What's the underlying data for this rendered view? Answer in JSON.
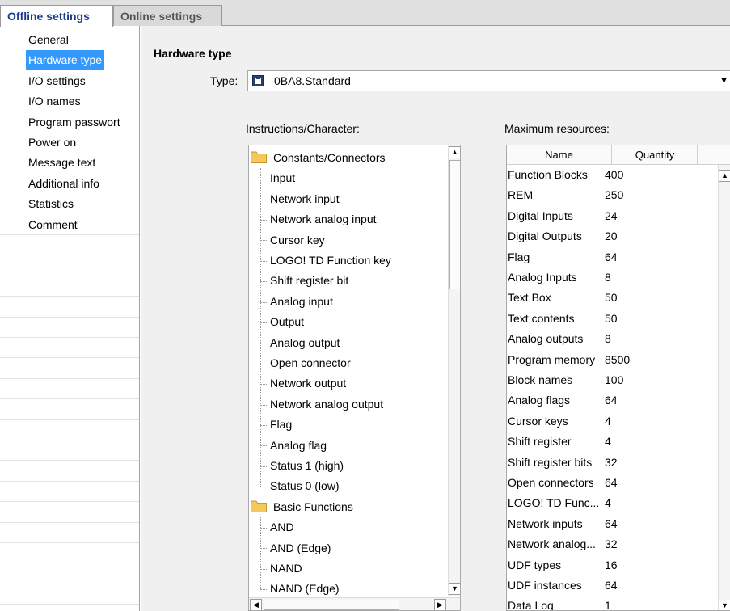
{
  "tabs": [
    {
      "label": "Offline settings",
      "active": true
    },
    {
      "label": "Online settings",
      "active": false
    }
  ],
  "sidebar": {
    "selected_index": 1,
    "items": [
      {
        "label": "General"
      },
      {
        "label": "Hardware type"
      },
      {
        "label": "I/O settings"
      },
      {
        "label": "I/O names"
      },
      {
        "label": "Program passwort"
      },
      {
        "label": "Power on"
      },
      {
        "label": "Message text"
      },
      {
        "label": "Additional info"
      },
      {
        "label": "Statistics"
      },
      {
        "label": "Comment"
      }
    ]
  },
  "hardware": {
    "section_title": "Hardware type",
    "type_label": "Type:",
    "type_value": "0BA8.Standard",
    "instructions_label": "Instructions/Character:",
    "resources_label": "Maximum resources:"
  },
  "instructions_tree": [
    {
      "label": "Constants/Connectors",
      "kind": "folder"
    },
    {
      "label": "Input",
      "kind": "child"
    },
    {
      "label": "Network input",
      "kind": "child"
    },
    {
      "label": "Network analog input",
      "kind": "child"
    },
    {
      "label": "Cursor key",
      "kind": "child"
    },
    {
      "label": "LOGO! TD Function key",
      "kind": "child"
    },
    {
      "label": "Shift register bit",
      "kind": "child"
    },
    {
      "label": "Analog input",
      "kind": "child"
    },
    {
      "label": "Output",
      "kind": "child"
    },
    {
      "label": "Analog output",
      "kind": "child"
    },
    {
      "label": "Open connector",
      "kind": "child"
    },
    {
      "label": "Network output",
      "kind": "child"
    },
    {
      "label": "Network analog output",
      "kind": "child"
    },
    {
      "label": "Flag",
      "kind": "child"
    },
    {
      "label": "Analog flag",
      "kind": "child"
    },
    {
      "label": "Status 1 (high)",
      "kind": "child"
    },
    {
      "label": "Status 0 (low)",
      "kind": "child"
    },
    {
      "label": "Basic Functions",
      "kind": "folder"
    },
    {
      "label": "AND",
      "kind": "child"
    },
    {
      "label": "AND (Edge)",
      "kind": "child"
    },
    {
      "label": "NAND",
      "kind": "child"
    },
    {
      "label": "NAND (Edge)",
      "kind": "child"
    }
  ],
  "resources": {
    "headers": {
      "name": "Name",
      "quantity": "Quantity"
    },
    "rows": [
      {
        "name": "Function Blocks",
        "quantity": "400"
      },
      {
        "name": "REM",
        "quantity": "250"
      },
      {
        "name": "Digital Inputs",
        "quantity": "24"
      },
      {
        "name": "Digital Outputs",
        "quantity": "20"
      },
      {
        "name": "Flag",
        "quantity": "64"
      },
      {
        "name": "Analog Inputs",
        "quantity": "8"
      },
      {
        "name": "Text Box",
        "quantity": "50"
      },
      {
        "name": "Text contents",
        "quantity": "50"
      },
      {
        "name": "Analog outputs",
        "quantity": "8"
      },
      {
        "name": "Program memory",
        "quantity": "8500"
      },
      {
        "name": "Block names",
        "quantity": "100"
      },
      {
        "name": "Analog flags",
        "quantity": "64"
      },
      {
        "name": "Cursor keys",
        "quantity": "4"
      },
      {
        "name": "Shift register",
        "quantity": "4"
      },
      {
        "name": "Shift register bits",
        "quantity": "32"
      },
      {
        "name": "Open connectors",
        "quantity": "64"
      },
      {
        "name": "LOGO! TD Func...",
        "quantity": "4"
      },
      {
        "name": "Network inputs",
        "quantity": "64"
      },
      {
        "name": "Network analog...",
        "quantity": "32"
      },
      {
        "name": "UDF types",
        "quantity": "16"
      },
      {
        "name": "UDF instances",
        "quantity": "64"
      },
      {
        "name": "Data Log",
        "quantity": "1"
      }
    ]
  },
  "icons": {
    "folder": "folder-icon",
    "hardware": "plc-chip-icon",
    "dropdown": "chevron-down-icon",
    "scroll_up": "scroll-up-arrow-icon",
    "scroll_down": "scroll-down-arrow-icon",
    "scroll_left": "scroll-left-arrow-icon",
    "scroll_right": "scroll-right-arrow-icon"
  },
  "colors": {
    "selection": "#3399ff",
    "active_tab_text": "#1b3a8c",
    "folder": "#f5c85c",
    "panel_bg": "#f0f0f0"
  }
}
